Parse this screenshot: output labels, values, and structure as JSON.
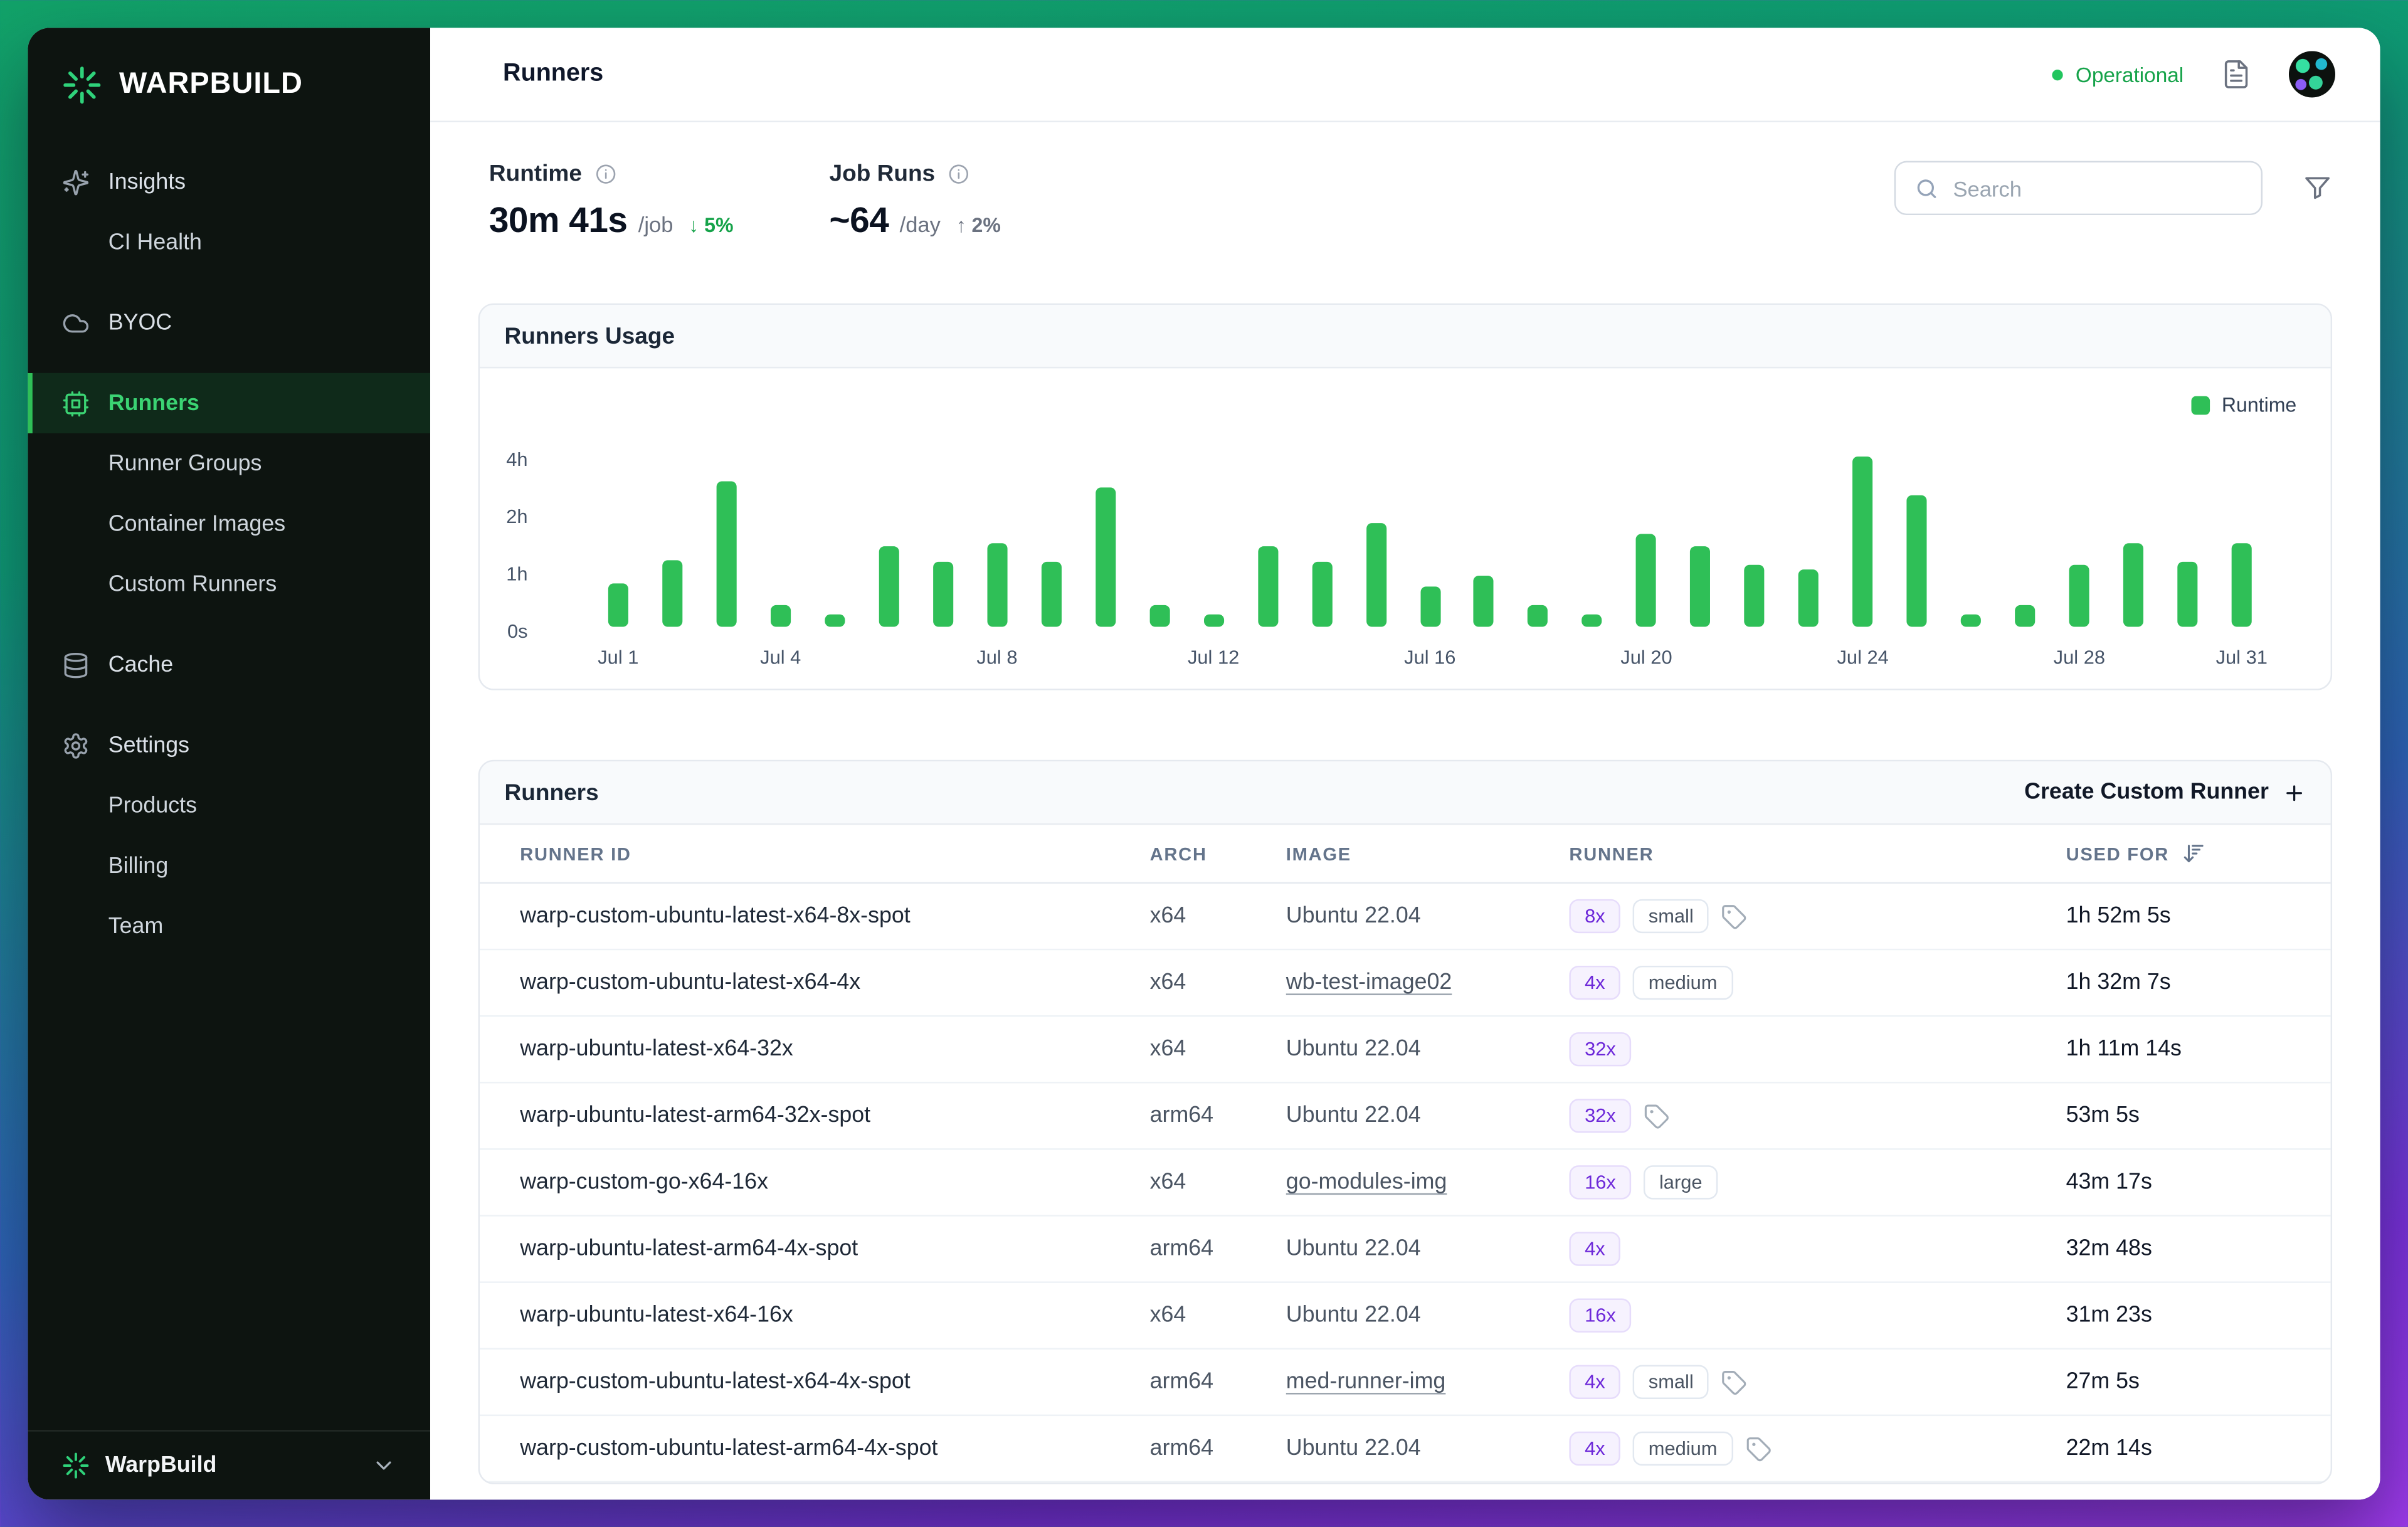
{
  "brand": {
    "name": "WARPBUILD",
    "footer_org": "WarpBuild"
  },
  "sidebar": {
    "nav": [
      {
        "label": "Insights"
      },
      {
        "label": "CI Health"
      },
      {
        "label": "BYOC"
      },
      {
        "label": "Runners"
      },
      {
        "label": "Runner Groups"
      },
      {
        "label": "Container Images"
      },
      {
        "label": "Custom Runners"
      },
      {
        "label": "Cache"
      },
      {
        "label": "Settings"
      },
      {
        "label": "Products"
      },
      {
        "label": "Billing"
      },
      {
        "label": "Team"
      }
    ]
  },
  "header": {
    "title": "Runners",
    "status": "Operational"
  },
  "stats": {
    "runtime": {
      "label": "Runtime",
      "value": "30m 41s",
      "unit": "/job",
      "trend": "↓ 5%",
      "trend_color": "#16a34a"
    },
    "job_runs": {
      "label": "Job Runs",
      "value": "~64",
      "unit": "/day",
      "trend": "↑ 2%",
      "trend_color": "#6b7280"
    }
  },
  "search": {
    "placeholder": "Search"
  },
  "usage_card": {
    "title": "Runners Usage",
    "legend": "Runtime"
  },
  "chart_data": {
    "type": "bar",
    "title": "Runners Usage",
    "series_name": "Runtime",
    "bar_color": "#2fbf57",
    "x": [
      "Jul 1",
      "Jul 2",
      "Jul 3",
      "Jul 4",
      "Jul 5",
      "Jul 6",
      "Jul 7",
      "Jul 8",
      "Jul 9",
      "Jul 10",
      "Jul 11",
      "Jul 12",
      "Jul 13",
      "Jul 14",
      "Jul 15",
      "Jul 16",
      "Jul 17",
      "Jul 18",
      "Jul 19",
      "Jul 20",
      "Jul 21",
      "Jul 22",
      "Jul 23",
      "Jul 24",
      "Jul 25",
      "Jul 26",
      "Jul 27",
      "Jul 28",
      "Jul 29",
      "Jul 30",
      "Jul 31"
    ],
    "values_hours": [
      0.76,
      1.15,
      3.07,
      0.39,
      0.23,
      1.41,
      1.13,
      1.46,
      1.13,
      2.85,
      0.39,
      0.23,
      1.41,
      1.13,
      1.8,
      0.7,
      0.9,
      0.39,
      0.23,
      1.63,
      1.41,
      1.07,
      0.99,
      3.92,
      2.62,
      0.23,
      0.39,
      1.07,
      1.46,
      1.13,
      1.46
    ],
    "yticks": [
      "4h",
      "2h",
      "1h",
      "0s"
    ],
    "tick_indices": [
      0,
      3,
      7,
      11,
      15,
      19,
      23,
      27,
      30
    ],
    "y_scale": "equal spacing between 0s, 1h, 2h, 4h gridlines",
    "grid": false,
    "legend_position": "top-right"
  },
  "table": {
    "title": "Runners",
    "create_button": "Create Custom Runner",
    "columns": [
      "RUNNER ID",
      "ARCH",
      "IMAGE",
      "RUNNER",
      "USED FOR"
    ],
    "rows": [
      {
        "id": "warp-custom-ubuntu-latest-x64-8x-spot",
        "arch": "x64",
        "image": "Ubuntu 22.04",
        "image_link": false,
        "badges": [
          {
            "label": "8x",
            "kind": "mult"
          },
          {
            "label": "small",
            "kind": "size"
          }
        ],
        "tag": true,
        "used": "1h 52m 5s"
      },
      {
        "id": "warp-custom-ubuntu-latest-x64-4x",
        "arch": "x64",
        "image": "wb-test-image02",
        "image_link": true,
        "badges": [
          {
            "label": "4x",
            "kind": "mult"
          },
          {
            "label": "medium",
            "kind": "size"
          }
        ],
        "tag": false,
        "used": "1h 32m 7s"
      },
      {
        "id": "warp-ubuntu-latest-x64-32x",
        "arch": "x64",
        "image": "Ubuntu 22.04",
        "image_link": false,
        "badges": [
          {
            "label": "32x",
            "kind": "mult"
          }
        ],
        "tag": false,
        "used": "1h 11m 14s"
      },
      {
        "id": "warp-ubuntu-latest-arm64-32x-spot",
        "arch": "arm64",
        "image": "Ubuntu 22.04",
        "image_link": false,
        "badges": [
          {
            "label": "32x",
            "kind": "mult"
          }
        ],
        "tag": true,
        "used": "53m 5s"
      },
      {
        "id": "warp-custom-go-x64-16x",
        "arch": "x64",
        "image": "go-modules-img",
        "image_link": true,
        "badges": [
          {
            "label": "16x",
            "kind": "mult"
          },
          {
            "label": "large",
            "kind": "size"
          }
        ],
        "tag": false,
        "used": "43m 17s"
      },
      {
        "id": "warp-ubuntu-latest-arm64-4x-spot",
        "arch": "arm64",
        "image": "Ubuntu 22.04",
        "image_link": false,
        "badges": [
          {
            "label": "4x",
            "kind": "mult"
          }
        ],
        "tag": false,
        "used": "32m 48s"
      },
      {
        "id": "warp-ubuntu-latest-x64-16x",
        "arch": "x64",
        "image": "Ubuntu 22.04",
        "image_link": false,
        "badges": [
          {
            "label": "16x",
            "kind": "mult"
          }
        ],
        "tag": false,
        "used": "31m 23s"
      },
      {
        "id": "warp-custom-ubuntu-latest-x64-4x-spot",
        "arch": "arm64",
        "image": "med-runner-img",
        "image_link": true,
        "badges": [
          {
            "label": "4x",
            "kind": "mult"
          },
          {
            "label": "small",
            "kind": "size"
          }
        ],
        "tag": true,
        "used": "27m 5s"
      },
      {
        "id": "warp-custom-ubuntu-latest-arm64-4x-spot",
        "arch": "arm64",
        "image": "Ubuntu 22.04",
        "image_link": false,
        "badges": [
          {
            "label": "4x",
            "kind": "mult"
          },
          {
            "label": "medium",
            "kind": "size"
          }
        ],
        "tag": true,
        "used": "22m 14s"
      }
    ]
  },
  "colors": {
    "accent_green": "#2fbf57",
    "status_green": "#16a34a",
    "badge_purple": "#6d28d9",
    "sidebar_bg": "#0d1410"
  }
}
